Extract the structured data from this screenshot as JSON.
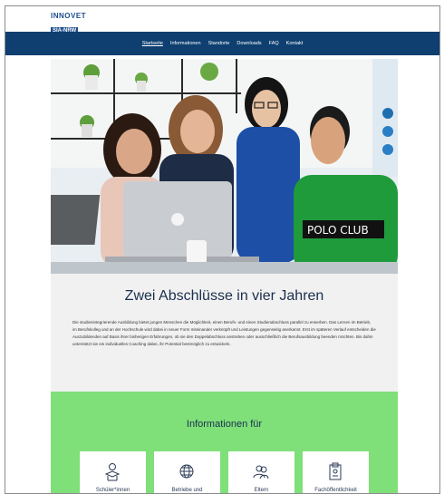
{
  "brand": {
    "line1": "INNOVET",
    "line2": "SIA-NRW"
  },
  "nav": {
    "items": [
      {
        "label": "Startseite",
        "active": true
      },
      {
        "label": "Informationen",
        "active": false
      },
      {
        "label": "Standorte",
        "active": false
      },
      {
        "label": "Downloads",
        "active": false
      },
      {
        "label": "FAQ",
        "active": false
      },
      {
        "label": "Kontakt",
        "active": false
      }
    ]
  },
  "hero": {
    "shirt_text": "POLO CLUB"
  },
  "intro": {
    "title": "Zwei Abschlüsse in vier Jahren",
    "body": "Die studienintegrierende Ausbildung bietet jungen Menschen die Möglichkeit, einen Berufs- und einen Studienabschluss parallel zu erwerben. Das Lernen im Betrieb, im Berufskolleg und an der Hochschule wird dabei in neuer Form miteinander verknüpft und Leistungen gegenseitig anerkannt. Erst im späteren Verlauf entscheiden die Auszubildenden auf Basis ihrer bisherigen Erfahrungen, ob sie den Doppelabschluss anstreben oder ausschließlich die Berufsausbildung beenden möchten. Bis dahin unterstützt sie ein individuelles Coaching dabei, ihr Potential bestmöglich zu entwickeln."
  },
  "info": {
    "title": "Informationen für",
    "cards": [
      {
        "label": "Schüler*innen",
        "icon": "student-icon"
      },
      {
        "label": "Betriebe und",
        "icon": "globe-icon"
      },
      {
        "label": "Eltern",
        "icon": "parents-icon"
      },
      {
        "label": "Fachöffentlichkeit",
        "icon": "clipboard-icon"
      }
    ]
  },
  "colors": {
    "nav": "#0e3f70",
    "accent": "#7fdf78",
    "headline_bg": "#f1f1f1"
  }
}
